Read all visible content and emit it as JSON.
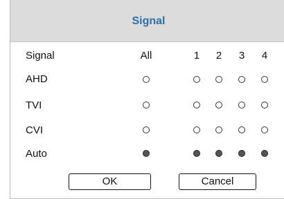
{
  "dialog": {
    "title": "Signal"
  },
  "grid": {
    "header_label": "Signal",
    "columns": [
      "All",
      "1",
      "2",
      "3",
      "4"
    ],
    "rows": [
      {
        "label": "AHD",
        "states": [
          "empty",
          "empty",
          "empty",
          "empty",
          "empty"
        ]
      },
      {
        "label": "TVI",
        "states": [
          "empty",
          "empty",
          "empty",
          "empty",
          "empty"
        ]
      },
      {
        "label": "CVI",
        "states": [
          "empty",
          "empty",
          "empty",
          "empty",
          "empty"
        ]
      },
      {
        "label": "Auto",
        "states": [
          "filled",
          "filled",
          "filled",
          "filled",
          "filled"
        ]
      }
    ]
  },
  "buttons": {
    "ok": "OK",
    "cancel": "Cancel"
  }
}
